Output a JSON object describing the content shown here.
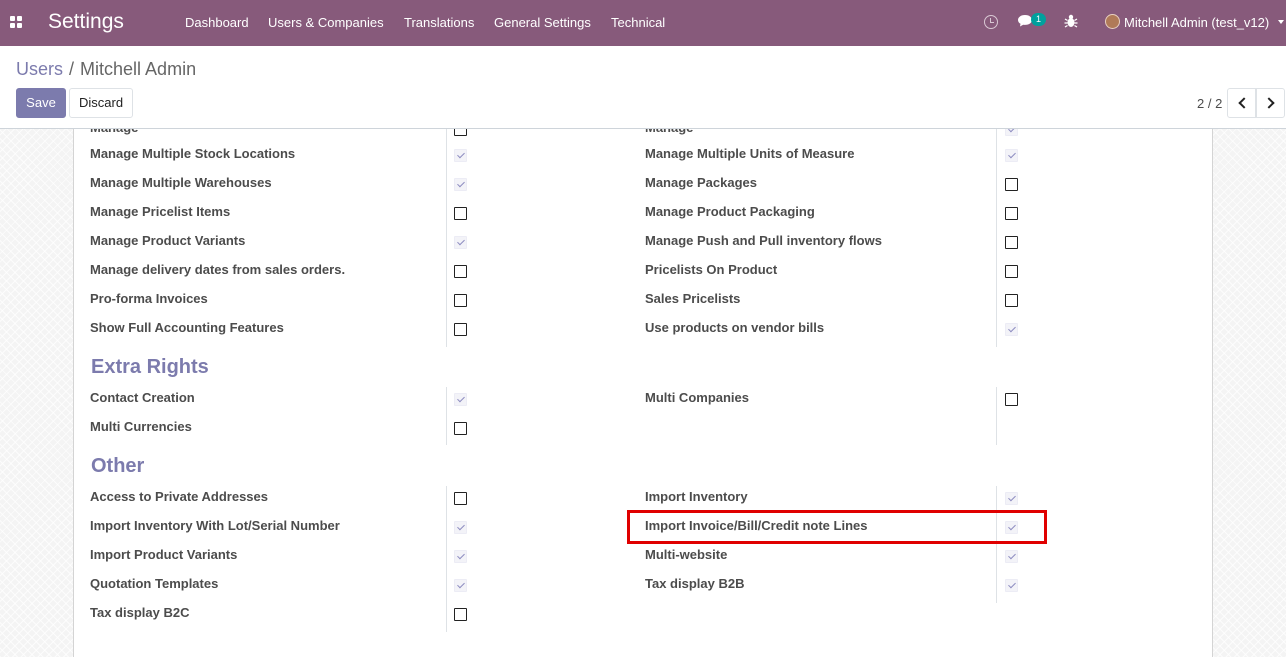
{
  "navbar": {
    "app_title": "Settings",
    "menu": [
      "Dashboard",
      "Users & Companies",
      "Translations",
      "General Settings",
      "Technical"
    ],
    "chat_badge": "1",
    "user_name": "Mitchell Admin (test_v12)",
    "icons": [
      "apps-icon",
      "clock-icon",
      "chat-icon",
      "bug-icon",
      "avatar",
      "caret-down-icon"
    ]
  },
  "breadcrumb": {
    "parent": "Users",
    "separator": "/",
    "current": "Mitchell Admin"
  },
  "buttons": {
    "save": "Save",
    "discard": "Discard"
  },
  "pager": {
    "value": "2 / 2"
  },
  "colors": {
    "navbar": "#875a7b",
    "primary": "#7c7bad",
    "highlight": "#e00000"
  },
  "sections": {
    "technical_rows_left": [
      {
        "label": "Manage Multiple Stock Locations",
        "checked": true
      },
      {
        "label": "Manage Multiple Warehouses",
        "checked": true
      },
      {
        "label": "Manage Pricelist Items",
        "checked": false
      },
      {
        "label": "Manage Product Variants",
        "checked": true
      },
      {
        "label": "Manage delivery dates from sales orders.",
        "checked": false
      },
      {
        "label": "Pro-forma Invoices",
        "checked": false
      },
      {
        "label": "Show Full Accounting Features",
        "checked": false
      }
    ],
    "technical_rows_right": [
      {
        "label": "Manage Multiple Units of Measure",
        "checked": true
      },
      {
        "label": "Manage Packages",
        "checked": false
      },
      {
        "label": "Manage Product Packaging",
        "checked": false
      },
      {
        "label": "Manage Push and Pull inventory flows",
        "checked": false
      },
      {
        "label": "Pricelists On Product",
        "checked": false
      },
      {
        "label": "Sales Pricelists",
        "checked": false
      },
      {
        "label": "Use products on vendor bills",
        "checked": true
      }
    ],
    "extra_rights": {
      "title": "Extra Rights",
      "left": [
        {
          "label": "Contact Creation",
          "checked": true
        },
        {
          "label": "Multi Currencies",
          "checked": false
        }
      ],
      "right": [
        {
          "label": "Multi Companies",
          "checked": false
        }
      ]
    },
    "other": {
      "title": "Other",
      "left": [
        {
          "label": "Access to Private Addresses",
          "checked": false
        },
        {
          "label": "Import Inventory With Lot/Serial Number",
          "checked": true
        },
        {
          "label": "Import Product Variants",
          "checked": true
        },
        {
          "label": "Quotation Templates",
          "checked": true
        },
        {
          "label": "Tax display B2C",
          "checked": false
        }
      ],
      "right": [
        {
          "label": "Import Inventory",
          "checked": true
        },
        {
          "label": "Import Invoice/Bill/Credit note Lines",
          "checked": true
        },
        {
          "label": "Multi-website",
          "checked": true
        },
        {
          "label": "Tax display B2B",
          "checked": true
        }
      ]
    }
  }
}
